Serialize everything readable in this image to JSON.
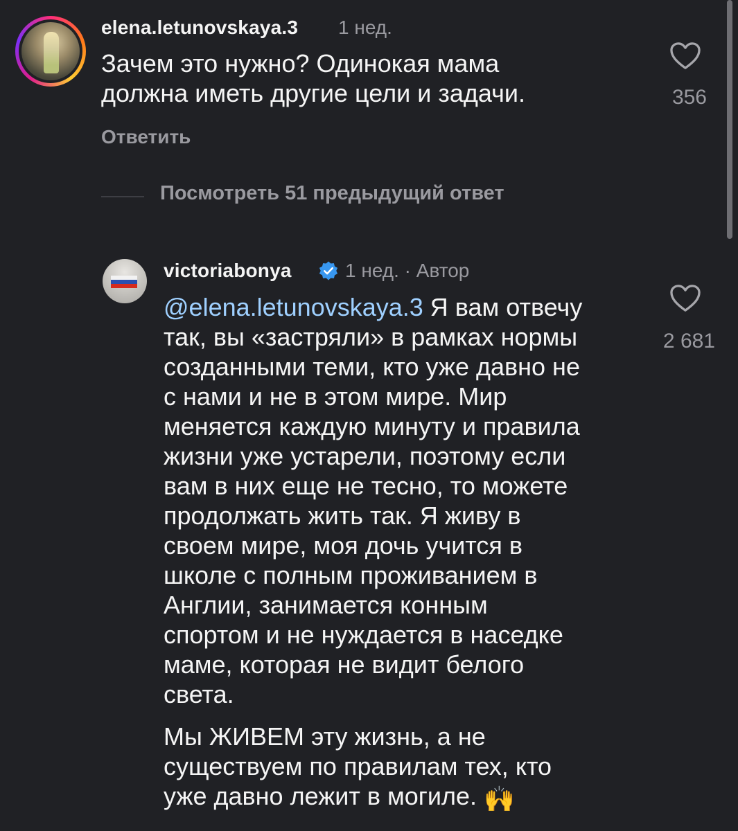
{
  "comment1": {
    "username": "elena.letunovskaya.3",
    "time": "1 нед.",
    "text": "Зачем это нужно? Одинокая мама\nдолжна иметь другие цели и задачи.",
    "likes": "356",
    "reply_label": "Ответить",
    "avatar_icon": "avatar-photo"
  },
  "view_replies": {
    "label": "Посмотреть 51 предыдущий ответ"
  },
  "comment2": {
    "username": "victoriabonya",
    "verified_icon": "verified-badge-icon",
    "meta": "1 нед. · Автор",
    "mention": "@elena.letunovskaya.3",
    "text_after_mention": " Я вам отвечу\nтак, вы «застряли» в рамках нормы\nсозданными теми, кто уже давно не\nс нами и не в этом мире. Мир\nменяется каждую минуту и правила\nжизни уже устарели, поэтому если\nвам в них еще не тесно, то можете\nпродолжать жить так. Я живу в\nсвоем мире, моя дочь учится в\nшколе с полным проживанием в\nАнглии, занимается конным\nспортом и не нуждается в наседке\nмаме, которая не видит белого\nсвета.",
    "paragraph2": "Мы ЖИВЕМ эту жизнь, а не\nсуществуем по правилам тех, кто\nуже давно лежит в могиле. ",
    "emoji": "🙌",
    "likes": "2 681"
  },
  "colors": {
    "background": "#202125",
    "text": "#f5f5f5",
    "secondary": "#9a9aa0",
    "mention": "#9fd0ff",
    "verified": "#3897f0"
  }
}
